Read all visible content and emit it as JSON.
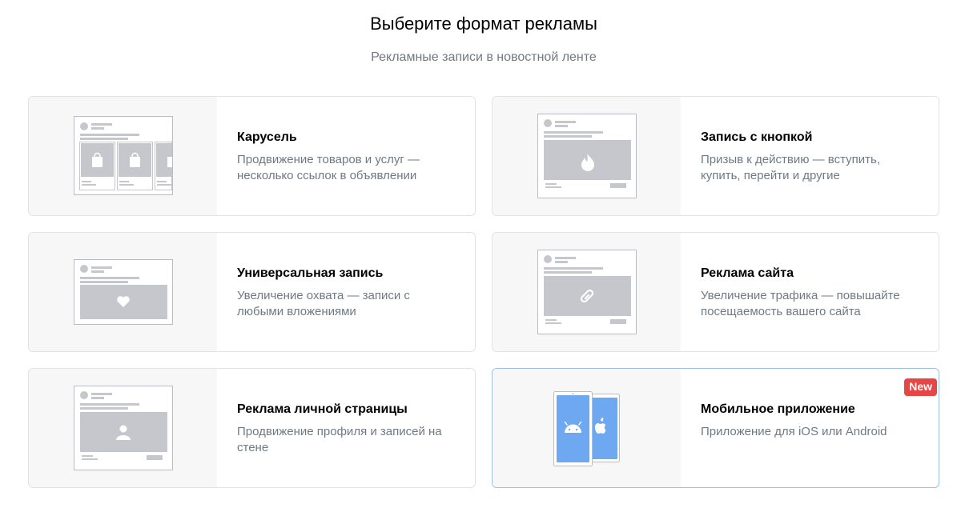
{
  "header": {
    "title": "Выберите формат рекламы",
    "subtitle": "Рекламные записи в новостной ленте"
  },
  "cards": [
    {
      "title": "Карусель",
      "description": "Продвижение товаров и услуг — несколько ссылок в объявлении",
      "icon": "carousel-illustration"
    },
    {
      "title": "Запись с кнопкой",
      "description": "Призыв к действию — вступить, купить, перейти и другие",
      "icon": "button-post-illustration"
    },
    {
      "title": "Универсальная запись",
      "description": "Увеличение охвата — записи с любыми вложениями",
      "icon": "universal-post-illustration"
    },
    {
      "title": "Реклама сайта",
      "description": "Увеличение трафика — повышайте посещаемость вашего сайта",
      "icon": "website-ad-illustration"
    },
    {
      "title": "Реклама личной страницы",
      "description": "Продвижение профиля и записей на стене",
      "icon": "personal-page-illustration"
    },
    {
      "title": "Мобильное приложение",
      "description": "Приложение для iOS или Android",
      "icon": "mobile-app-illustration",
      "badge": "New"
    }
  ],
  "colors": {
    "placeholder_gray": "#c5c7cc",
    "phone_blue": "#6ea8f0",
    "selected_border": "#9ec0e6",
    "badge_red": "#e64646",
    "muted_text": "#6f7985"
  }
}
